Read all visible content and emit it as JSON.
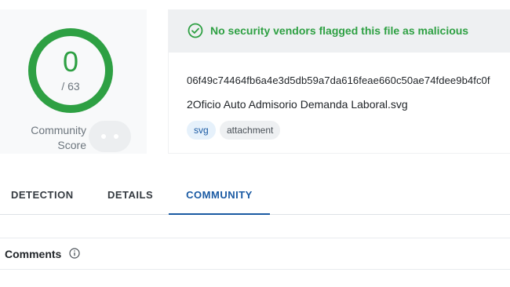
{
  "score": {
    "value": "0",
    "total": "/ 63",
    "ring_color": "#2ea043",
    "community_label_line1": "Community",
    "community_label_line2": "Score"
  },
  "verdict": {
    "icon": "check-circle-icon",
    "text": "No security vendors flagged this file as malicious",
    "color": "#2ea043"
  },
  "file": {
    "hash": "06f49c74464fb6a4e3d5db59a7da616feae660c50ae74fdee9b4fc0f",
    "name": "2Oficio Auto Admisorio Demanda Laboral.svg",
    "tags": [
      "svg",
      "attachment"
    ]
  },
  "tabs": {
    "items": [
      "DETECTION",
      "DETAILS",
      "COMMUNITY"
    ],
    "active": "COMMUNITY"
  },
  "comments": {
    "title": "Comments",
    "icon": "info-icon"
  }
}
